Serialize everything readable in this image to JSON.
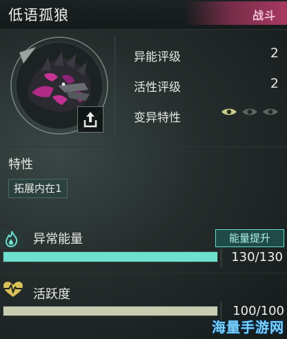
{
  "header": {
    "title": "低语孤狼",
    "battle_label": "战斗"
  },
  "stats": [
    {
      "label": "异能评级",
      "value": "2"
    },
    {
      "label": "活性评级",
      "value": "2"
    },
    {
      "label": "变异特性"
    }
  ],
  "mutation_eyes": [
    "active",
    "inactive",
    "inactive"
  ],
  "traits": {
    "heading": "特性",
    "items": [
      "拓展内在1"
    ]
  },
  "energy": {
    "label": "异常能量",
    "button_label": "能量提升",
    "value_text": "130/130",
    "current": 130,
    "max": 130
  },
  "activity": {
    "label": "活跃度",
    "value_text": "100/100",
    "current": 100,
    "max": 100
  },
  "colors": {
    "energy_fill": "#6de0cf",
    "activity_fill": "#c8ccb1",
    "battle_tag": "#b03a64",
    "accent_eye": "#c9c98a"
  },
  "icons": {
    "share": "share-icon",
    "energy": "flame-icon",
    "activity": "heartbeat-icon"
  },
  "watermark": "海量手游网"
}
